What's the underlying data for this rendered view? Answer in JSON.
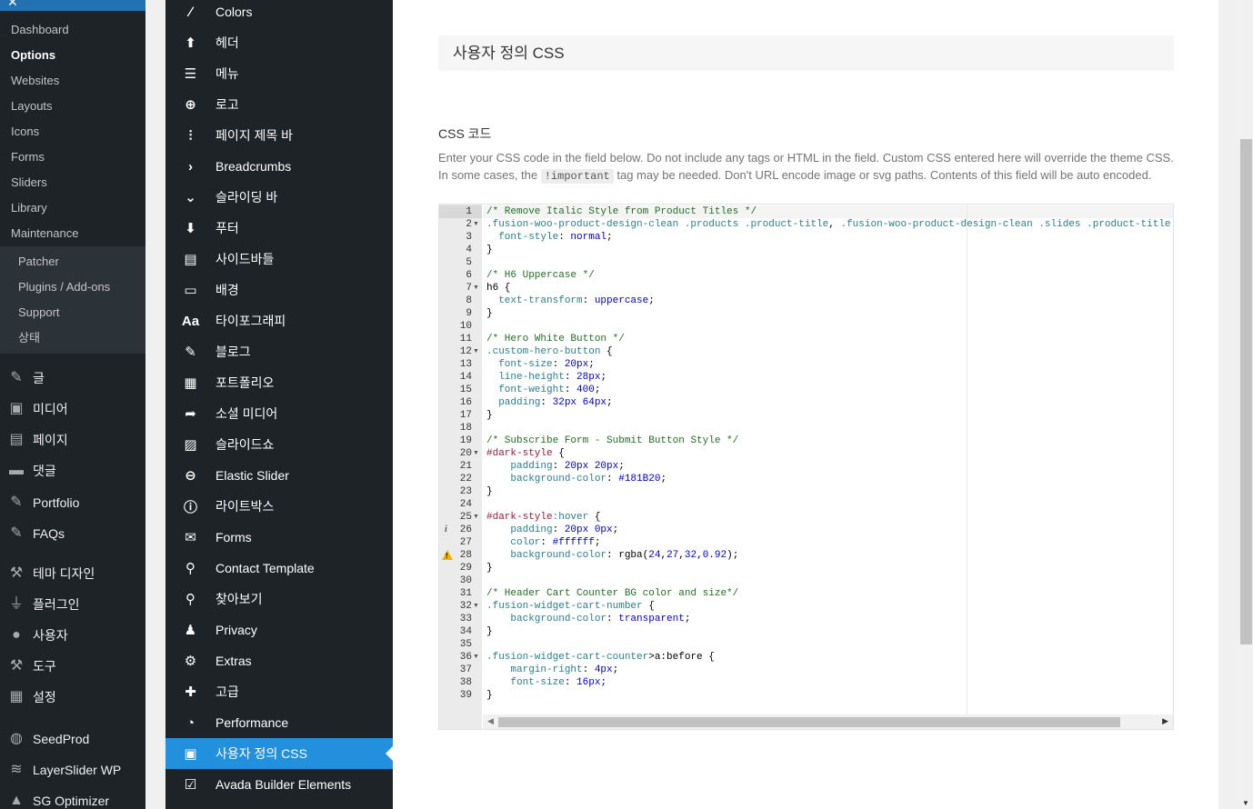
{
  "wp_sidebar": {
    "submenu": [
      {
        "label": "Dashboard",
        "current": false
      },
      {
        "label": "Options",
        "current": true
      },
      {
        "label": "Websites",
        "current": false
      },
      {
        "label": "Layouts",
        "current": false
      },
      {
        "label": "Icons",
        "current": false
      },
      {
        "label": "Forms",
        "current": false
      },
      {
        "label": "Sliders",
        "current": false
      },
      {
        "label": "Library",
        "current": false
      },
      {
        "label": "Maintenance",
        "current": false
      }
    ],
    "submenu2": [
      "Patcher",
      "Plugins / Add-ons",
      "Support",
      "상태"
    ],
    "top_items": [
      {
        "label": "글",
        "icon": "pin-icon"
      },
      {
        "label": "미디어",
        "icon": "media-icon"
      },
      {
        "label": "페이지",
        "icon": "page-icon"
      },
      {
        "label": "댓글",
        "icon": "comment-icon"
      },
      {
        "label": "Portfolio",
        "icon": "pin-icon"
      },
      {
        "label": "FAQs",
        "icon": "pin-icon"
      },
      {
        "label": "테마 디자인",
        "icon": "hammer-icon"
      },
      {
        "label": "플러그인",
        "icon": "plug-icon"
      },
      {
        "label": "사용자",
        "icon": "user-icon"
      },
      {
        "label": "도구",
        "icon": "wrench-icon"
      },
      {
        "label": "설정",
        "icon": "settings-icon"
      },
      {
        "label": "SeedProd",
        "icon": "seedprod-icon"
      },
      {
        "label": "LayerSlider WP",
        "icon": "layers-icon"
      },
      {
        "label": "SG Optimizer",
        "icon": "sg-icon"
      }
    ]
  },
  "options_menu": {
    "items": [
      {
        "label": "Colors",
        "icon": "brush-icon",
        "glyph": "∕"
      },
      {
        "label": "헤더",
        "icon": "arrow-up-icon",
        "glyph": "⬆"
      },
      {
        "label": "메뉴",
        "icon": "hamburger-icon",
        "glyph": "☰"
      },
      {
        "label": "로고",
        "icon": "plus-circle-icon",
        "glyph": "⊕"
      },
      {
        "label": "페이지 제목 바",
        "icon": "sliders-icon",
        "glyph": "⫶"
      },
      {
        "label": "Breadcrumbs",
        "icon": "chevron-right-icon",
        "glyph": "›"
      },
      {
        "label": "슬라이딩 바",
        "icon": "chevron-down-icon",
        "glyph": "⌄"
      },
      {
        "label": "푸터",
        "icon": "arrow-down-icon",
        "glyph": "⬇"
      },
      {
        "label": "사이드바들",
        "icon": "sidebar-icon",
        "glyph": "▤"
      },
      {
        "label": "배경",
        "icon": "monitor-icon",
        "glyph": "▭"
      },
      {
        "label": "타이포그래피",
        "icon": "typography-icon",
        "glyph": "Aa"
      },
      {
        "label": "블로그",
        "icon": "edit-icon",
        "glyph": "✎"
      },
      {
        "label": "포트폴리오",
        "icon": "grid-icon",
        "glyph": "▦"
      },
      {
        "label": "소셜 미디어",
        "icon": "share-icon",
        "glyph": "➦"
      },
      {
        "label": "슬라이드쇼",
        "icon": "image-icon",
        "glyph": "▨"
      },
      {
        "label": "Elastic Slider",
        "icon": "elastic-slider-icon",
        "glyph": "⊖"
      },
      {
        "label": "라이트박스",
        "icon": "info-icon",
        "glyph": "ⓘ"
      },
      {
        "label": "Forms",
        "icon": "envelope-icon",
        "glyph": "✉"
      },
      {
        "label": "Contact Template",
        "icon": "map-pin-icon",
        "glyph": "⚲"
      },
      {
        "label": "찾아보기",
        "icon": "search-icon",
        "glyph": "⚲"
      },
      {
        "label": "Privacy",
        "icon": "person-icon",
        "glyph": "♟"
      },
      {
        "label": "Extras",
        "icon": "gears-icon",
        "glyph": "⚙"
      },
      {
        "label": "고급",
        "icon": "puzzle-icon",
        "glyph": "✚"
      },
      {
        "label": "Performance",
        "icon": "gauge-icon",
        "glyph": "◔"
      },
      {
        "label": "사용자 정의 CSS",
        "icon": "css-icon",
        "glyph": "▣"
      },
      {
        "label": "Avada Builder Elements",
        "icon": "checkbox-icon",
        "glyph": "☑"
      }
    ],
    "active_index": 24
  },
  "content": {
    "section_title": "사용자 정의 CSS",
    "field_title": "CSS 코드",
    "desc_1": "Enter your CSS code in the field below. Do not include any tags or HTML in the field. Custom CSS entered here will override the theme CSS.",
    "desc_2a": "In some cases, the ",
    "desc_code": "!important",
    "desc_2b": " tag may be needed. Don't URL encode image or svg paths. Contents of this field will be auto encoded."
  },
  "editor": {
    "folds": [
      2,
      7,
      12,
      20,
      25,
      32,
      36
    ],
    "info_line": 26,
    "warning_line": 28,
    "lines": [
      [
        [
          "t-cm",
          "/* Remove Italic Style from Product Titles */"
        ]
      ],
      [
        [
          "t-sel",
          ".fusion-woo-product-design-clean .products .product-title"
        ],
        [
          "t-p",
          ", "
        ],
        [
          "t-sel",
          ".fusion-woo-product-design-clean .slides .product-title"
        ],
        [
          "t-p",
          " {"
        ]
      ],
      [
        [
          "t-p",
          "  "
        ],
        [
          "t-prop",
          "font-style"
        ],
        [
          "t-p",
          ": "
        ],
        [
          "t-val",
          "normal"
        ],
        [
          "t-p",
          ";"
        ]
      ],
      [
        [
          "t-p",
          "}"
        ]
      ],
      [],
      [
        [
          "t-cm",
          "/* H6 Uppercase */"
        ]
      ],
      [
        [
          "t-tag",
          "h6"
        ],
        [
          "t-p",
          " {"
        ]
      ],
      [
        [
          "t-p",
          "  "
        ],
        [
          "t-prop",
          "text-transform"
        ],
        [
          "t-p",
          ": "
        ],
        [
          "t-val",
          "uppercase"
        ],
        [
          "t-p",
          ";"
        ]
      ],
      [
        [
          "t-p",
          "}"
        ]
      ],
      [],
      [
        [
          "t-cm",
          "/* Hero White Button */"
        ]
      ],
      [
        [
          "t-sel",
          ".custom-hero-button"
        ],
        [
          "t-p",
          " {"
        ]
      ],
      [
        [
          "t-p",
          "  "
        ],
        [
          "t-prop",
          "font-size"
        ],
        [
          "t-p",
          ": "
        ],
        [
          "t-num",
          "20px"
        ],
        [
          "t-p",
          ";"
        ]
      ],
      [
        [
          "t-p",
          "  "
        ],
        [
          "t-prop",
          "line-height"
        ],
        [
          "t-p",
          ": "
        ],
        [
          "t-num",
          "28px"
        ],
        [
          "t-p",
          ";"
        ]
      ],
      [
        [
          "t-p",
          "  "
        ],
        [
          "t-prop",
          "font-weight"
        ],
        [
          "t-p",
          ": "
        ],
        [
          "t-num",
          "400"
        ],
        [
          "t-p",
          ";"
        ]
      ],
      [
        [
          "t-p",
          "  "
        ],
        [
          "t-prop",
          "padding"
        ],
        [
          "t-p",
          ": "
        ],
        [
          "t-num",
          "32px 64px"
        ],
        [
          "t-p",
          ";"
        ]
      ],
      [
        [
          "t-p",
          "}"
        ]
      ],
      [],
      [
        [
          "t-cm",
          "/* Subscribe Form - Submit Button Style */"
        ]
      ],
      [
        [
          "t-id",
          "#dark-style"
        ],
        [
          "t-p",
          " {"
        ]
      ],
      [
        [
          "t-p",
          "    "
        ],
        [
          "t-prop",
          "padding"
        ],
        [
          "t-p",
          ": "
        ],
        [
          "t-num",
          "20px 20px"
        ],
        [
          "t-p",
          ";"
        ]
      ],
      [
        [
          "t-p",
          "    "
        ],
        [
          "t-prop",
          "background-color"
        ],
        [
          "t-p",
          ": "
        ],
        [
          "t-val",
          "#181B20"
        ],
        [
          "t-p",
          ";"
        ]
      ],
      [
        [
          "t-p",
          "}"
        ]
      ],
      [],
      [
        [
          "t-id",
          "#dark-style"
        ],
        [
          "t-sel",
          ":hover"
        ],
        [
          "t-p",
          " {"
        ]
      ],
      [
        [
          "t-p",
          "    "
        ],
        [
          "t-prop",
          "padding"
        ],
        [
          "t-p",
          ": "
        ],
        [
          "t-num",
          "20px 0px"
        ],
        [
          "t-p",
          ";"
        ]
      ],
      [
        [
          "t-p",
          "    "
        ],
        [
          "t-prop",
          "color"
        ],
        [
          "t-p",
          ": "
        ],
        [
          "t-val",
          "#ffffff"
        ],
        [
          "t-p",
          ";"
        ]
      ],
      [
        [
          "t-p",
          "    "
        ],
        [
          "t-prop",
          "background-color"
        ],
        [
          "t-p",
          ": "
        ],
        [
          "t-p",
          "rgba("
        ],
        [
          "t-num",
          "24"
        ],
        [
          "t-p",
          ","
        ],
        [
          "t-num",
          "27"
        ],
        [
          "t-p",
          ","
        ],
        [
          "t-num",
          "32"
        ],
        [
          "t-p",
          ","
        ],
        [
          "t-num",
          "0.92"
        ],
        [
          "t-p",
          ");"
        ]
      ],
      [
        [
          "t-p",
          "}"
        ]
      ],
      [],
      [
        [
          "t-cm",
          "/* Header Cart Counter BG color and size*/"
        ]
      ],
      [
        [
          "t-sel",
          ".fusion-widget-cart-number"
        ],
        [
          "t-p",
          " {"
        ]
      ],
      [
        [
          "t-p",
          "    "
        ],
        [
          "t-prop",
          "background-color"
        ],
        [
          "t-p",
          ": "
        ],
        [
          "t-val",
          "transparent"
        ],
        [
          "t-p",
          ";"
        ]
      ],
      [
        [
          "t-p",
          "}"
        ]
      ],
      [],
      [
        [
          "t-sel",
          ".fusion-widget-cart-counter"
        ],
        [
          "t-p",
          ">a:before {"
        ]
      ],
      [
        [
          "t-p",
          "    "
        ],
        [
          "t-prop",
          "margin-right"
        ],
        [
          "t-p",
          ": "
        ],
        [
          "t-num",
          "4px"
        ],
        [
          "t-p",
          ";"
        ]
      ],
      [
        [
          "t-p",
          "    "
        ],
        [
          "t-prop",
          "font-size"
        ],
        [
          "t-p",
          ": "
        ],
        [
          "t-num",
          "16px"
        ],
        [
          "t-p",
          ";"
        ]
      ],
      [
        [
          "t-p",
          "}"
        ]
      ]
    ]
  },
  "colors": {
    "admin_bg": "#1d2327",
    "active_blue": "#2290dc",
    "wp_blue": "#2271b1"
  }
}
